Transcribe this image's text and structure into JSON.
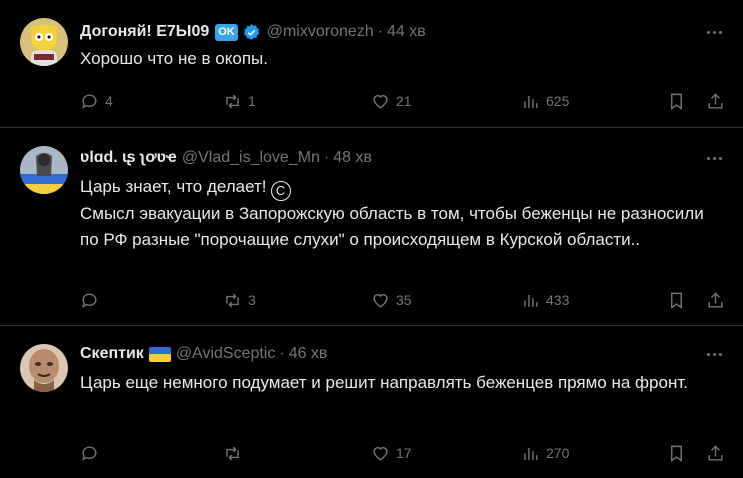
{
  "tweets": [
    {
      "name": "Догоняй! Е7Ы09",
      "badge": "OK",
      "verified": true,
      "handle": "@mixvoronezh",
      "dot": "·",
      "time": "44 хв",
      "text": [
        "Хорошо что не в окопы."
      ],
      "replies": "4",
      "retweets": "1",
      "likes": "21",
      "views": "625",
      "avatar_color": "#e3b629"
    },
    {
      "name": "ʋlɑd. ɩʂ ʅơʋҽ",
      "handle": "@Vlad_is_love_Mn",
      "dot": "·",
      "time": "48 хв",
      "text_line1": "Царь знает, что делает!",
      "copy_symbol": "C",
      "text": [
        "Смысл эвакуации в Запорожскую область в том, чтобы беженцы не разносили по РФ разные \"порочащие слухи\" о происходящем в Курской области.."
      ],
      "replies": "",
      "retweets": "3",
      "likes": "35",
      "views": "433",
      "avatar_color": "#6d7d8f"
    },
    {
      "name": "Скептик",
      "flag": "ukraine-flag",
      "handle": "@AvidSceptic",
      "dot": "·",
      "time": "46 хв",
      "text": [
        "Царь еще немного подумает и решит направлять беженцев прямо на фронт."
      ],
      "replies": "",
      "retweets": "",
      "likes": "17",
      "views": "270",
      "avatar_color": "#b88a6e"
    }
  ],
  "colors": {
    "background": "#000000",
    "text": "#e7e9ea",
    "muted": "#71767b",
    "divider": "#2f3336",
    "verified": "#1d9bf0"
  },
  "icons": [
    "reply-icon",
    "retweet-icon",
    "like-icon",
    "views-icon",
    "bookmark-icon",
    "share-icon",
    "more-icon",
    "verified-icon"
  ]
}
